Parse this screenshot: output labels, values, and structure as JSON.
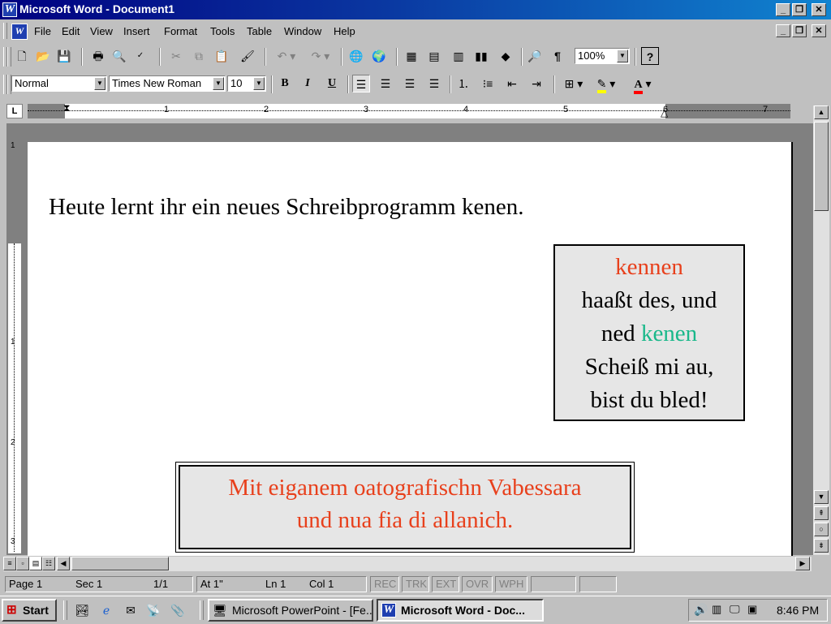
{
  "window": {
    "title": "Microsoft Word - Document1",
    "app_icon": "word-icon"
  },
  "menu": [
    "File",
    "Edit",
    "View",
    "Insert",
    "Format",
    "Tools",
    "Table",
    "Window",
    "Help"
  ],
  "toolbar": {
    "zoom": "100%",
    "paragraph_mark": "¶",
    "help_mark": "?"
  },
  "format": {
    "style": "Normal",
    "font": "Times New Roman",
    "size": "10",
    "bold": "B",
    "italic": "I",
    "underline": "U",
    "font_color_mark": "A"
  },
  "ruler": {
    "marks": [
      "1",
      "2",
      "3",
      "4",
      "5",
      "6",
      "7"
    ],
    "vmarks": [
      "1",
      "1",
      "2",
      "3"
    ]
  },
  "document": {
    "line1": "Heute lernt ihr ein neues Schreibprogramm kenen.",
    "box1": {
      "red_word": "kennen",
      "line2": "haaßt des, und",
      "line3_prefix": "ned",
      "green_word": "kenen",
      "line4": "Scheiß mi au,",
      "line5": "bist du bled!"
    },
    "box2": {
      "line1": "Mit eiganem oatografischn Vabessara",
      "line2": "und nua fia di allanich."
    }
  },
  "status": {
    "page": "Page  1",
    "sec": "Sec  1",
    "pages": "1/1",
    "at": "At  1\"",
    "ln": "Ln  1",
    "col": "Col  1",
    "rec": "REC",
    "trk": "TRK",
    "ext": "EXT",
    "ovr": "OVR",
    "wph": "WPH"
  },
  "taskbar": {
    "start": "Start",
    "task1": "Microsoft PowerPoint - [Fe...",
    "task2": "Microsoft Word - Doc...",
    "clock": "8:46 PM"
  },
  "colors": {
    "red": "#e8401c",
    "green": "#19b88a",
    "title": "#000080"
  }
}
